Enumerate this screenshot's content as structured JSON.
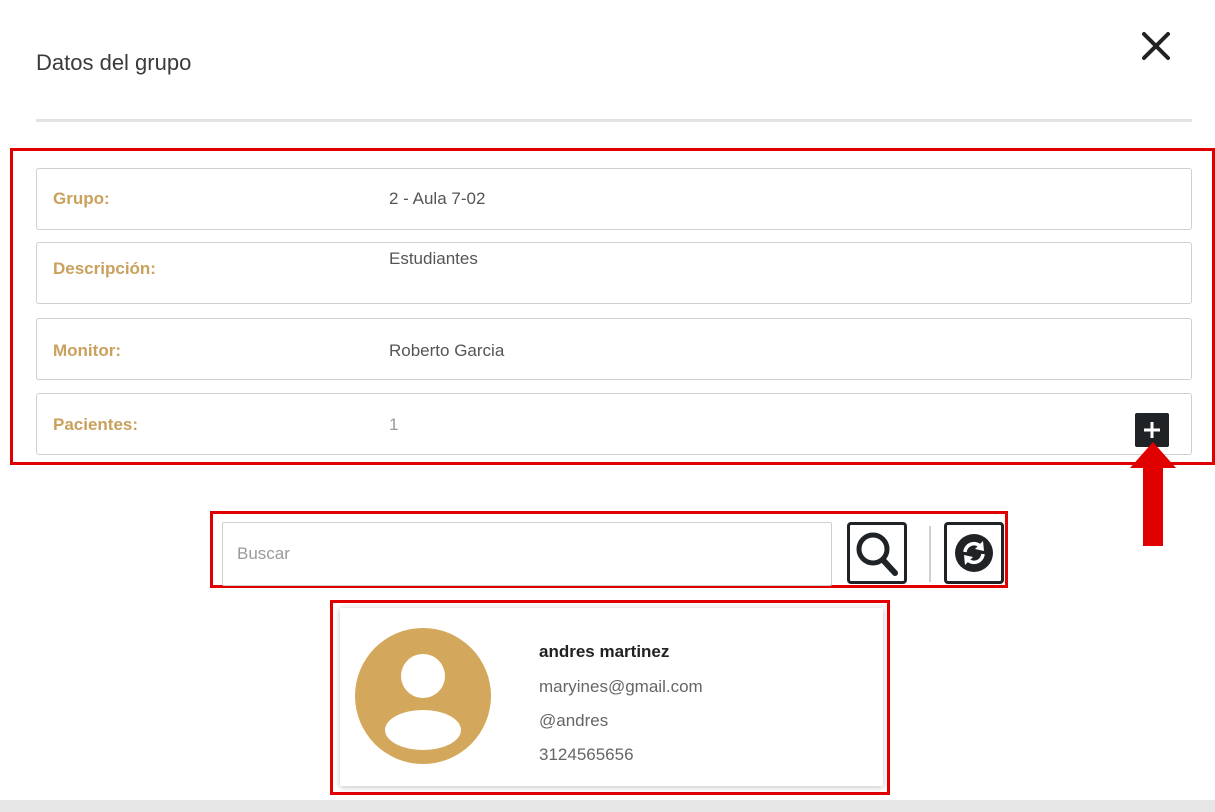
{
  "dialog": {
    "title": "Datos del grupo"
  },
  "group_fields": {
    "grupo": {
      "label": "Grupo:",
      "value": "2 - Aula 7-02"
    },
    "descripcion": {
      "label": "Descripción:",
      "value": "Estudiantes"
    },
    "monitor": {
      "label": "Monitor:",
      "value": "Roberto Garcia"
    },
    "pacientes": {
      "label": "Pacientes:",
      "value": "1"
    }
  },
  "search": {
    "placeholder": "Buscar",
    "value": ""
  },
  "patient_card": {
    "name": "andres martinez",
    "email": "maryines@gmail.com",
    "username": "@andres",
    "phone": "3124565656"
  },
  "icons": {
    "close": "close-icon",
    "add": "plus-icon",
    "search": "magnifier-icon",
    "refresh": "refresh-icon",
    "avatar": "user-avatar-icon"
  },
  "colors": {
    "label_gold": "#c9a05c",
    "avatar_gold": "#d4a85c",
    "highlight_red": "#e00000",
    "dark_button": "#1f2326"
  }
}
